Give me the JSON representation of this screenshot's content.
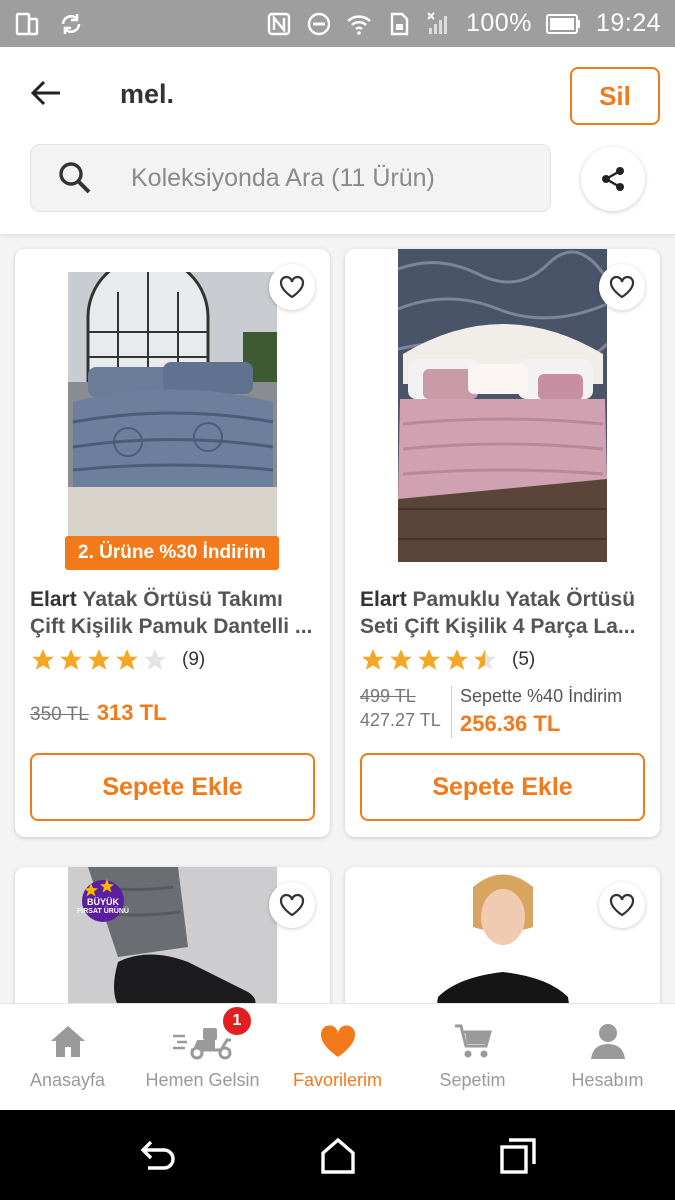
{
  "status_bar": {
    "battery": "100%",
    "time": "19:24"
  },
  "header": {
    "title": "mel.",
    "delete_label": "Sil",
    "search_placeholder": "Koleksiyonda Ara (11 Ürün)"
  },
  "products": [
    {
      "brand": "Elart",
      "name": "Yatak Örtüsü Takımı Çift Kişilik Pamuk Dantelli ...",
      "promo": "2. Ürüne %30 İndirim",
      "rating": 4,
      "rating_count": "(9)",
      "old_price": "350 TL",
      "price": "313 TL",
      "button": "Sepete Ekle"
    },
    {
      "brand": "Elart",
      "name": "Pamuklu Yatak Örtüsü Seti Çift Kişilik 4 Parça La...",
      "rating": 4.5,
      "rating_count": "(5)",
      "old_price": "499 TL",
      "mid_price": "427.27 TL",
      "basket_discount": "Sepette %40 İndirim",
      "price": "256.36 TL",
      "button": "Sepete Ekle"
    },
    {
      "badge": [
        "BÜYÜK",
        "FIRSAT ÜRÜNÜ"
      ]
    },
    {}
  ],
  "bottom_nav": [
    {
      "label": "Anasayfa",
      "icon": "home-icon"
    },
    {
      "label": "Hemen Gelsin",
      "icon": "delivery-scooter-icon",
      "badge": "1"
    },
    {
      "label": "Favorilerim",
      "icon": "heart-icon",
      "active": true
    },
    {
      "label": "Sepetim",
      "icon": "cart-icon"
    },
    {
      "label": "Hesabım",
      "icon": "user-icon"
    }
  ],
  "colors": {
    "accent": "#f27a1a",
    "star": "#f5a623",
    "badge": "#e02020"
  }
}
